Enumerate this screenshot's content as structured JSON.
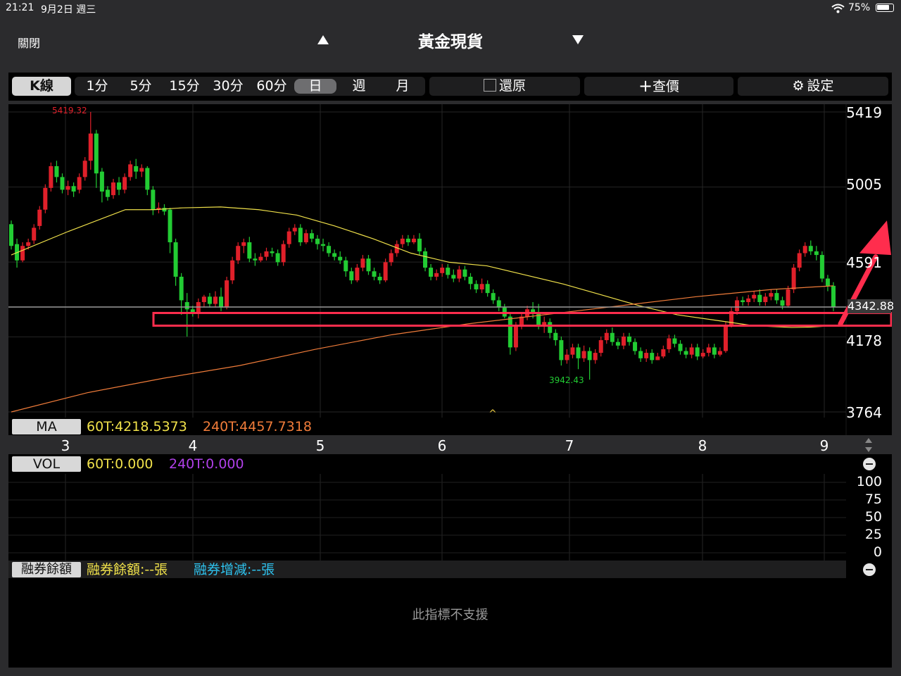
{
  "status": {
    "time": "21:21",
    "date": "9月2日 週三",
    "battery": "75%"
  },
  "nav": {
    "close": "關閉",
    "title": "黃金現貨"
  },
  "toolbar": {
    "kline": "K線",
    "periods": [
      "1分",
      "5分",
      "15分",
      "30分",
      "60分",
      "日",
      "週",
      "月"
    ],
    "restore": "還原",
    "quote": "查價",
    "settings": "設定"
  },
  "price_axis": {
    "labels": [
      "5419",
      "5005",
      "4591",
      "4178",
      "3764"
    ],
    "current": "4342.88"
  },
  "chart_data": {
    "type": "candlestick",
    "x_ticks": [
      "3",
      "4",
      "5",
      "6",
      "7",
      "8",
      "9"
    ],
    "ylim": [
      3764,
      5419
    ],
    "y_ticks": [
      5419,
      5005,
      4591,
      4178,
      3764
    ],
    "high_label": "5419.32",
    "low_label": "3942.43",
    "current_price": 4342.88,
    "candles": [
      [
        4800,
        4680,
        4820,
        4660
      ],
      [
        4690,
        4600,
        4720,
        4560
      ],
      [
        4600,
        4680,
        4700,
        4590
      ],
      [
        4680,
        4700,
        4720,
        4660
      ],
      [
        4710,
        4780,
        4800,
        4690
      ],
      [
        4790,
        4880,
        4900,
        4770
      ],
      [
        4880,
        5000,
        5020,
        4860
      ],
      [
        5000,
        5120,
        5140,
        4980
      ],
      [
        5120,
        5060,
        5150,
        5030
      ],
      [
        5060,
        4990,
        5080,
        4970
      ],
      [
        4990,
        5010,
        5040,
        4960
      ],
      [
        5010,
        4980,
        5030,
        4950
      ],
      [
        4990,
        5060,
        5080,
        4970
      ],
      [
        5060,
        5150,
        5170,
        5040
      ],
      [
        5150,
        5300,
        5419,
        5100
      ],
      [
        5300,
        5080,
        5320,
        5000
      ],
      [
        5090,
        4980,
        5110,
        4920
      ],
      [
        4990,
        4950,
        5010,
        4930
      ],
      [
        4960,
        5030,
        5050,
        4940
      ],
      [
        5030,
        4990,
        5060,
        4960
      ],
      [
        4990,
        5060,
        5080,
        4970
      ],
      [
        5060,
        5130,
        5150,
        5040
      ],
      [
        5120,
        5090,
        5160,
        5050
      ],
      [
        5090,
        5110,
        5130,
        5060
      ],
      [
        5110,
        4990,
        5120,
        4960
      ],
      [
        4990,
        4880,
        5010,
        4850
      ],
      [
        4880,
        4890,
        4920,
        4860
      ],
      [
        4890,
        4870,
        4910,
        4850
      ],
      [
        4880,
        4700,
        4890,
        4640
      ],
      [
        4700,
        4510,
        4720,
        4460
      ],
      [
        4510,
        4380,
        4530,
        4300
      ],
      [
        4370,
        4330,
        4420,
        4180
      ],
      [
        4330,
        4310,
        4350,
        4290
      ],
      [
        4310,
        4370,
        4390,
        4280
      ],
      [
        4370,
        4400,
        4410,
        4340
      ],
      [
        4400,
        4360,
        4420,
        4340
      ],
      [
        4360,
        4400,
        4430,
        4340
      ],
      [
        4400,
        4340,
        4450,
        4320
      ],
      [
        4340,
        4490,
        4510,
        4330
      ],
      [
        4490,
        4600,
        4620,
        4470
      ],
      [
        4600,
        4680,
        4700,
        4580
      ],
      [
        4680,
        4700,
        4720,
        4640
      ],
      [
        4700,
        4610,
        4730,
        4590
      ],
      [
        4610,
        4600,
        4640,
        4570
      ],
      [
        4600,
        4620,
        4640,
        4590
      ],
      [
        4620,
        4650,
        4670,
        4600
      ],
      [
        4650,
        4640,
        4670,
        4620
      ],
      [
        4640,
        4590,
        4660,
        4570
      ],
      [
        4590,
        4690,
        4710,
        4570
      ],
      [
        4690,
        4760,
        4780,
        4670
      ],
      [
        4760,
        4780,
        4800,
        4740
      ],
      [
        4780,
        4700,
        4800,
        4680
      ],
      [
        4700,
        4750,
        4770,
        4690
      ],
      [
        4750,
        4720,
        4770,
        4700
      ],
      [
        4720,
        4690,
        4740,
        4660
      ],
      [
        4690,
        4680,
        4720,
        4650
      ],
      [
        4680,
        4640,
        4700,
        4620
      ],
      [
        4640,
        4620,
        4660,
        4600
      ],
      [
        4620,
        4600,
        4650,
        4580
      ],
      [
        4600,
        4540,
        4620,
        4510
      ],
      [
        4540,
        4490,
        4560,
        4470
      ],
      [
        4490,
        4560,
        4580,
        4480
      ],
      [
        4560,
        4610,
        4630,
        4540
      ],
      [
        4610,
        4540,
        4630,
        4520
      ],
      [
        4540,
        4510,
        4560,
        4490
      ],
      [
        4510,
        4490,
        4530,
        4470
      ],
      [
        4490,
        4590,
        4610,
        4480
      ],
      [
        4590,
        4640,
        4660,
        4570
      ],
      [
        4640,
        4690,
        4710,
        4620
      ],
      [
        4690,
        4720,
        4740,
        4670
      ],
      [
        4720,
        4700,
        4740,
        4680
      ],
      [
        4700,
        4720,
        4740,
        4690
      ],
      [
        4720,
        4650,
        4750,
        4630
      ],
      [
        4650,
        4560,
        4670,
        4540
      ],
      [
        4560,
        4510,
        4580,
        4490
      ],
      [
        4510,
        4530,
        4550,
        4490
      ],
      [
        4530,
        4560,
        4580,
        4510
      ],
      [
        4560,
        4520,
        4580,
        4500
      ],
      [
        4520,
        4500,
        4550,
        4480
      ],
      [
        4500,
        4550,
        4570,
        4480
      ],
      [
        4550,
        4510,
        4570,
        4490
      ],
      [
        4510,
        4470,
        4530,
        4440
      ],
      [
        4470,
        4440,
        4490,
        4420
      ],
      [
        4440,
        4470,
        4500,
        4420
      ],
      [
        4470,
        4420,
        4490,
        4400
      ],
      [
        4420,
        4380,
        4440,
        4360
      ],
      [
        4380,
        4340,
        4400,
        4320
      ],
      [
        4340,
        4290,
        4360,
        4280
      ],
      [
        4290,
        4120,
        4310,
        4080
      ],
      [
        4120,
        4240,
        4260,
        4100
      ],
      [
        4240,
        4290,
        4310,
        4220
      ],
      [
        4290,
        4330,
        4350,
        4270
      ],
      [
        4330,
        4310,
        4370,
        4280
      ],
      [
        4310,
        4240,
        4360,
        4220
      ],
      [
        4240,
        4260,
        4290,
        4200
      ],
      [
        4260,
        4200,
        4280,
        4170
      ],
      [
        4200,
        4160,
        4220,
        4130
      ],
      [
        4160,
        4050,
        4180,
        4020
      ],
      [
        4050,
        4080,
        4110,
        4030
      ],
      [
        4080,
        4120,
        4140,
        4060
      ],
      [
        4120,
        4060,
        4140,
        4000
      ],
      [
        4060,
        4100,
        4130,
        4040
      ],
      [
        4100,
        4050,
        4120,
        3942
      ],
      [
        4050,
        4090,
        4110,
        4030
      ],
      [
        4090,
        4160,
        4180,
        4070
      ],
      [
        4160,
        4200,
        4220,
        4140
      ],
      [
        4200,
        4150,
        4230,
        4130
      ],
      [
        4150,
        4130,
        4170,
        4110
      ],
      [
        4130,
        4180,
        4200,
        4110
      ],
      [
        4180,
        4150,
        4200,
        4130
      ],
      [
        4150,
        4100,
        4170,
        4080
      ],
      [
        4100,
        4060,
        4120,
        4040
      ],
      [
        4060,
        4090,
        4110,
        4040
      ],
      [
        4090,
        4050,
        4110,
        4030
      ],
      [
        4050,
        4070,
        4090,
        4050
      ],
      [
        4070,
        4110,
        4130,
        4060
      ],
      [
        4110,
        4170,
        4190,
        4090
      ],
      [
        4170,
        4140,
        4190,
        4120
      ],
      [
        4140,
        4100,
        4160,
        4080
      ],
      [
        4100,
        4080,
        4120,
        4060
      ],
      [
        4080,
        4120,
        4140,
        4060
      ],
      [
        4120,
        4070,
        4140,
        4050
      ],
      [
        4070,
        4090,
        4110,
        4060
      ],
      [
        4090,
        4120,
        4140,
        4070
      ],
      [
        4120,
        4080,
        4140,
        4060
      ],
      [
        4080,
        4100,
        4120,
        4070
      ],
      [
        4100,
        4240,
        4260,
        4090
      ],
      [
        4240,
        4320,
        4340,
        4230
      ],
      [
        4320,
        4380,
        4400,
        4300
      ],
      [
        4380,
        4370,
        4400,
        4350
      ],
      [
        4370,
        4390,
        4410,
        4350
      ],
      [
        4390,
        4410,
        4430,
        4370
      ],
      [
        4410,
        4370,
        4440,
        4350
      ],
      [
        4370,
        4400,
        4420,
        4350
      ],
      [
        4400,
        4420,
        4440,
        4380
      ],
      [
        4420,
        4380,
        4440,
        4360
      ],
      [
        4380,
        4350,
        4400,
        4330
      ],
      [
        4350,
        4440,
        4460,
        4340
      ],
      [
        4440,
        4560,
        4580,
        4420
      ],
      [
        4560,
        4640,
        4660,
        4540
      ],
      [
        4640,
        4680,
        4700,
        4620
      ],
      [
        4680,
        4650,
        4710,
        4630
      ],
      [
        4650,
        4630,
        4680,
        4600
      ],
      [
        4630,
        4500,
        4650,
        4480
      ],
      [
        4500,
        4460,
        4520,
        4430
      ],
      [
        4460,
        4342.88,
        4480,
        4320
      ]
    ],
    "ma": [
      {
        "name": "60T",
        "label": "60T:4218.5373",
        "color": "#f0e14a",
        "points": [
          [
            0,
            4630
          ],
          [
            30,
            4760
          ],
          [
            60,
            4880
          ],
          [
            75,
            4880
          ],
          [
            90,
            4890
          ],
          [
            110,
            4895
          ],
          [
            130,
            4880
          ],
          [
            150,
            4850
          ],
          [
            170,
            4790
          ],
          [
            190,
            4720
          ],
          [
            210,
            4640
          ],
          [
            230,
            4590
          ],
          [
            250,
            4570
          ],
          [
            270,
            4520
          ],
          [
            290,
            4470
          ],
          [
            310,
            4410
          ],
          [
            330,
            4350
          ],
          [
            350,
            4300
          ],
          [
            370,
            4270
          ],
          [
            390,
            4240
          ],
          [
            410,
            4230
          ],
          [
            420,
            4232
          ],
          [
            432,
            4240
          ]
        ]
      },
      {
        "name": "240T",
        "label": "240T:4457.7318",
        "color": "#f07c3a",
        "points": [
          [
            0,
            3764
          ],
          [
            40,
            3870
          ],
          [
            80,
            3950
          ],
          [
            120,
            4020
          ],
          [
            160,
            4110
          ],
          [
            200,
            4190
          ],
          [
            240,
            4250
          ],
          [
            280,
            4300
          ],
          [
            320,
            4350
          ],
          [
            360,
            4400
          ],
          [
            400,
            4440
          ],
          [
            432,
            4460
          ]
        ]
      }
    ],
    "vol": {
      "labels": [
        "60T:0.000",
        "240T:0.000"
      ],
      "ylim": [
        0,
        100
      ],
      "y_ticks": [
        100,
        75,
        50,
        25,
        0
      ]
    },
    "margin": {
      "label": "融券餘額",
      "balance": "融券餘額:--張",
      "change": "融券增減:--張",
      "notice": "此指標不支援"
    }
  },
  "colors": {
    "up": "#e0202a",
    "down": "#22cc33",
    "annotation": "#ff2d4d"
  }
}
